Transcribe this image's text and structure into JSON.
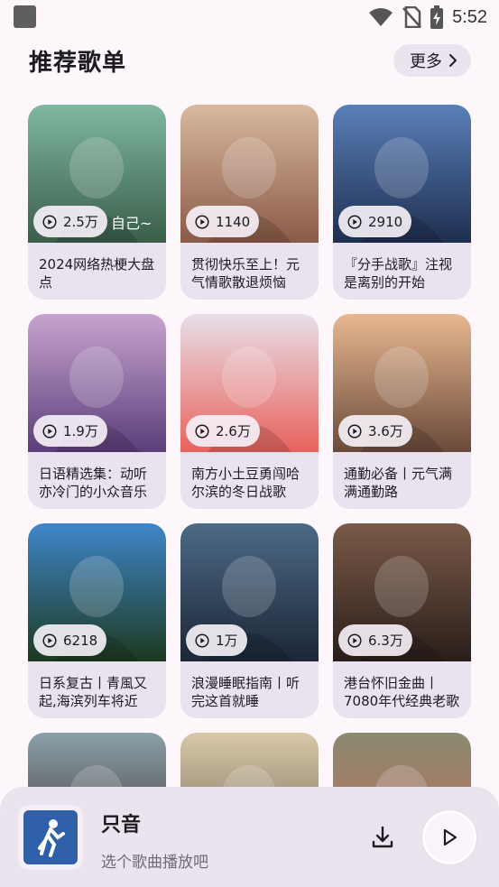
{
  "status_bar": {
    "time": "5:52"
  },
  "header": {
    "title": "推荐歌单",
    "more_label": "更多"
  },
  "playlists": [
    {
      "plays": "2.5万",
      "title": "2024网络热梗大盘点",
      "cover_text": "自己~",
      "colors": [
        "#7fb7a0",
        "#3a5e4a"
      ]
    },
    {
      "plays": "1140",
      "title": "贯彻快乐至上！元气情歌散退烦恼",
      "colors": [
        "#d9b9a0",
        "#8a5a48"
      ]
    },
    {
      "plays": "2910",
      "title": "『分手战歌』注视是离别的开始",
      "colors": [
        "#5a7fb8",
        "#1e2f50"
      ]
    },
    {
      "plays": "1.9万",
      "title": "日语精选集：动听亦冷门的小众音乐",
      "colors": [
        "#c7a4cf",
        "#5b3e7a"
      ]
    },
    {
      "plays": "2.6万",
      "title": "南方小土豆勇闯哈尔滨的冬日战歌",
      "colors": [
        "#e7dfe8",
        "#e8625c"
      ]
    },
    {
      "plays": "3.6万",
      "title": "通勤必备丨元气满满通勤路",
      "colors": [
        "#e7b790",
        "#6a4a3a"
      ]
    },
    {
      "plays": "6218",
      "title": "日系复古丨青風又起,海滨列车将近",
      "colors": [
        "#3f86c9",
        "#1d3a20"
      ]
    },
    {
      "plays": "1万",
      "title": "浪漫睡眠指南丨听完这首就睡",
      "colors": [
        "#4c6a86",
        "#1c2636"
      ]
    },
    {
      "plays": "6.3万",
      "title": "港台怀旧金曲丨7080年代经典老歌",
      "colors": [
        "#7a5a48",
        "#2a1e1a"
      ]
    },
    {
      "plays": "",
      "title": "",
      "colors": [
        "#8aa0a8",
        "#3a2a28"
      ]
    },
    {
      "plays": "",
      "title": "",
      "colors": [
        "#d8c8a8",
        "#6a6050"
      ]
    },
    {
      "plays": "",
      "title": "",
      "colors": [
        "#8a8a70",
        "#c46a5a"
      ]
    }
  ],
  "player": {
    "track_title": "只音",
    "track_subtitle": "选个歌曲播放吧",
    "accent_color": "#2f5fa8"
  }
}
